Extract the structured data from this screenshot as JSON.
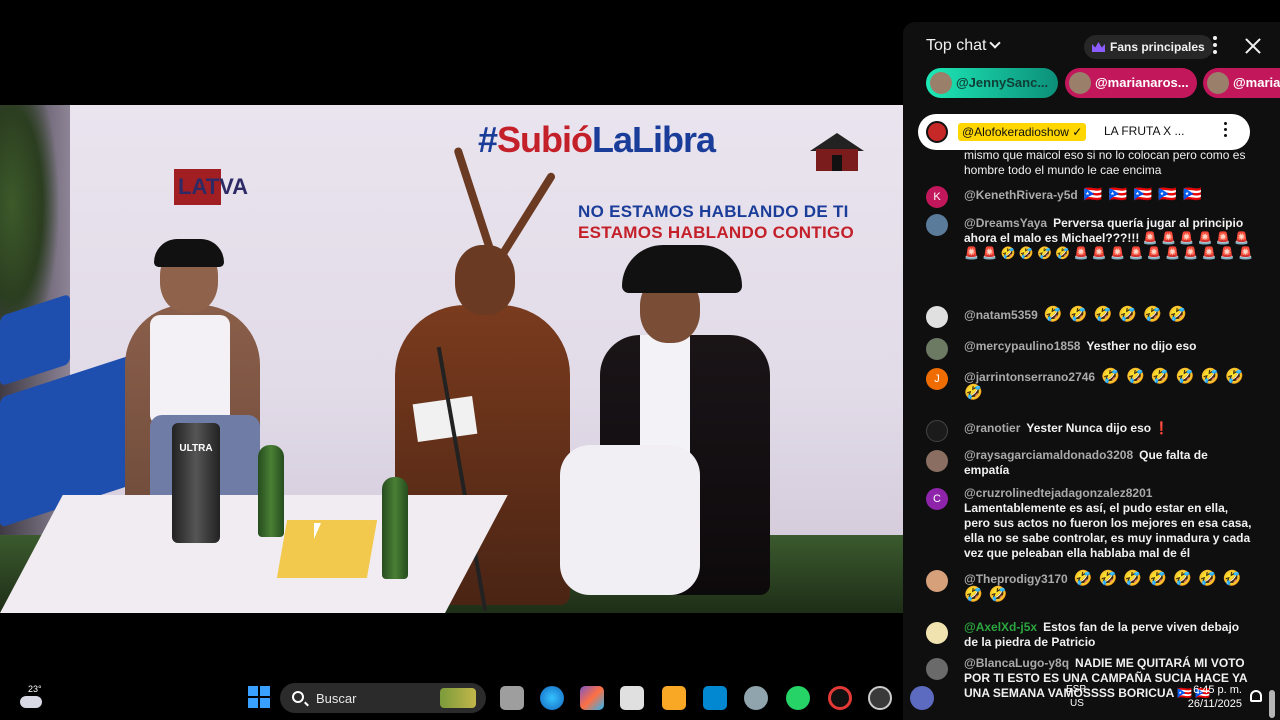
{
  "video": {
    "sign_hashtag_hash": "#",
    "sign_hashtag_red": "Subió",
    "sign_hashtag_blue": "LaLibra",
    "sign_line1": "NO ESTAMOS HABLANDO DE TI",
    "sign_line2": "ESTAMOS HABLANDO CONTIGO",
    "sign_left": "LATVA",
    "tumbler_label": "ULTRA"
  },
  "chat": {
    "title": "Top chat",
    "fans_label": "Fans principales",
    "ticker": [
      {
        "name": "@JennySanc..."
      },
      {
        "name": "@marianaros..."
      },
      {
        "name": "@maria"
      }
    ],
    "pinned": {
      "channel": "@Alofokeradioshow ✓",
      "message": "LA FRUTA X ..."
    },
    "messages": [
      {
        "author": "",
        "text": "mismo que maicol eso si no lo colocan pero como es hombre todo el mundo le cae encima"
      },
      {
        "author": "@KenethRivera-y5d",
        "text": "🇵🇷 🇵🇷 🇵🇷 🇵🇷 🇵🇷",
        "avatar_letter": "K",
        "avatar_color": "#c2185b"
      },
      {
        "author": "@DreamsYaya",
        "text": "Perversa quería jugar al principio ahora el malo es Michael???!!! 🚨 🚨 🚨 🚨 🚨 🚨 🚨 🚨 🤣 🤣 🤣 🤣 🚨 🚨 🚨 🚨 🚨 🚨 🚨 🚨 🚨 🚨"
      },
      {
        "author": "@natam5359",
        "text": "🤣 🤣 🤣 🤣 🤣 🤣"
      },
      {
        "author": "@mercypaulino1858",
        "text": "Yesther no dijo eso"
      },
      {
        "author": "@jarrintonserrano2746",
        "text": "🤣 🤣 🤣 🤣 🤣 🤣 🤣",
        "avatar_letter": "J",
        "avatar_color": "#ef6c00"
      },
      {
        "author": "@ranotier",
        "text": "Yester Nunca dijo eso ❗"
      },
      {
        "author": "@raysagarciamaldonado3208",
        "text": "Que falta de empatía"
      },
      {
        "author": "@cruzrolinedtejadagonzalez8201",
        "text": "Lamentablemente es así, el pudo estar en ella, pero sus actos no fueron los mejores en esa casa, ella no se sabe controlar, es muy inmadura y cada vez que peleaban ella hablaba mal de él",
        "avatar_letter": "C",
        "avatar_color": "#8e24aa"
      },
      {
        "author": "@Theprodigy3170",
        "text": "🤣 🤣 🤣 🤣 🤣 🤣 🤣 🤣 🤣"
      },
      {
        "author": "@AxelXd-j5x",
        "text": "Estos fan de la perve viven debajo de la piedra de Patricio"
      },
      {
        "author": "@BlancaLugo-y8q",
        "text": "NADIE ME QUITARÁ MI VOTO POR TI ESTO ES UNA CAMPAÑA SUCIA HACE YA UNA SEMANA VAMOSSSS BORICUA 🇵🇷 🇵🇷"
      }
    ]
  },
  "taskbar": {
    "temperature": "23°",
    "search_label": "Buscar",
    "clock": "6:45 p. m.",
    "date": "26/11/2025",
    "lang1": "ESP",
    "lang2": "US"
  }
}
